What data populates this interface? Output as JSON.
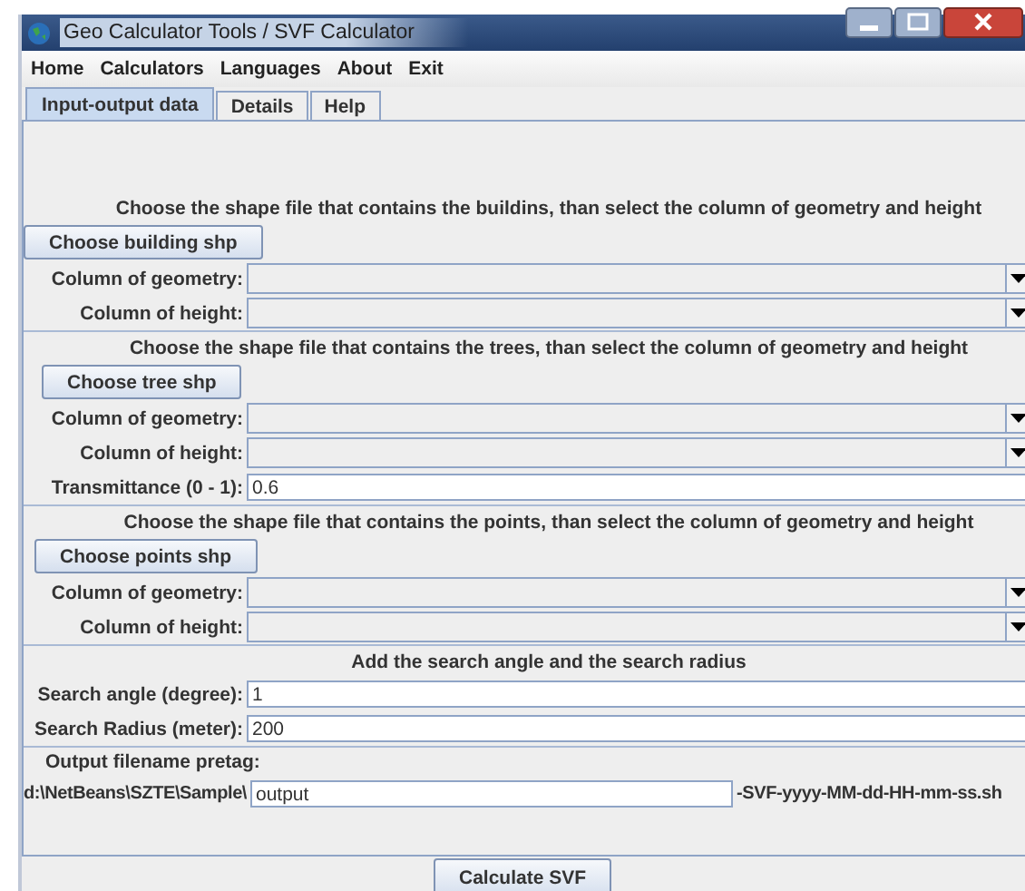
{
  "window": {
    "title": "Geo Calculator Tools / SVF Calculator"
  },
  "menu": [
    "Home",
    "Calculators",
    "Languages",
    "About",
    "Exit"
  ],
  "tabs": [
    {
      "label": "Input-output data",
      "selected": true
    },
    {
      "label": "Details",
      "selected": false
    },
    {
      "label": "Help",
      "selected": false
    }
  ],
  "sections": [
    {
      "heading": "Choose the shape file that contains the buildins, than select the column of geometry and height",
      "button": "Choose building shp",
      "fields": [
        {
          "kind": "combo",
          "label": "Column of geometry:"
        },
        {
          "kind": "combo",
          "label": "Column of height:"
        }
      ]
    },
    {
      "heading": "Choose the shape file that contains the trees, than select the column of geometry and height",
      "button": "Choose tree shp",
      "fields": [
        {
          "kind": "combo",
          "label": "Column of geometry:"
        },
        {
          "kind": "combo",
          "label": "Column of height:"
        },
        {
          "kind": "text",
          "label": "Transmittance (0 - 1):",
          "value": "0.6"
        }
      ]
    },
    {
      "heading": "Choose the shape file that contains the points, than select the column of geometry and height",
      "button": "Choose points shp",
      "fields": [
        {
          "kind": "combo",
          "label": "Column of geometry:"
        },
        {
          "kind": "combo",
          "label": "Column of height:"
        }
      ]
    },
    {
      "heading": "Add the search angle and the search radius",
      "fields": [
        {
          "kind": "text",
          "label": "Search angle (degree):",
          "value": "1"
        },
        {
          "kind": "text",
          "label": "Search Radius (meter):",
          "value": "200"
        }
      ]
    }
  ],
  "output": {
    "label": "Output filename pretag:",
    "path": "d:\\NetBeans\\SZTE\\Sample\\",
    "value": "output",
    "suffix": "-SVF-yyyy-MM-dd-HH-mm-ss.sh"
  },
  "action_button": "Calculate SVF"
}
